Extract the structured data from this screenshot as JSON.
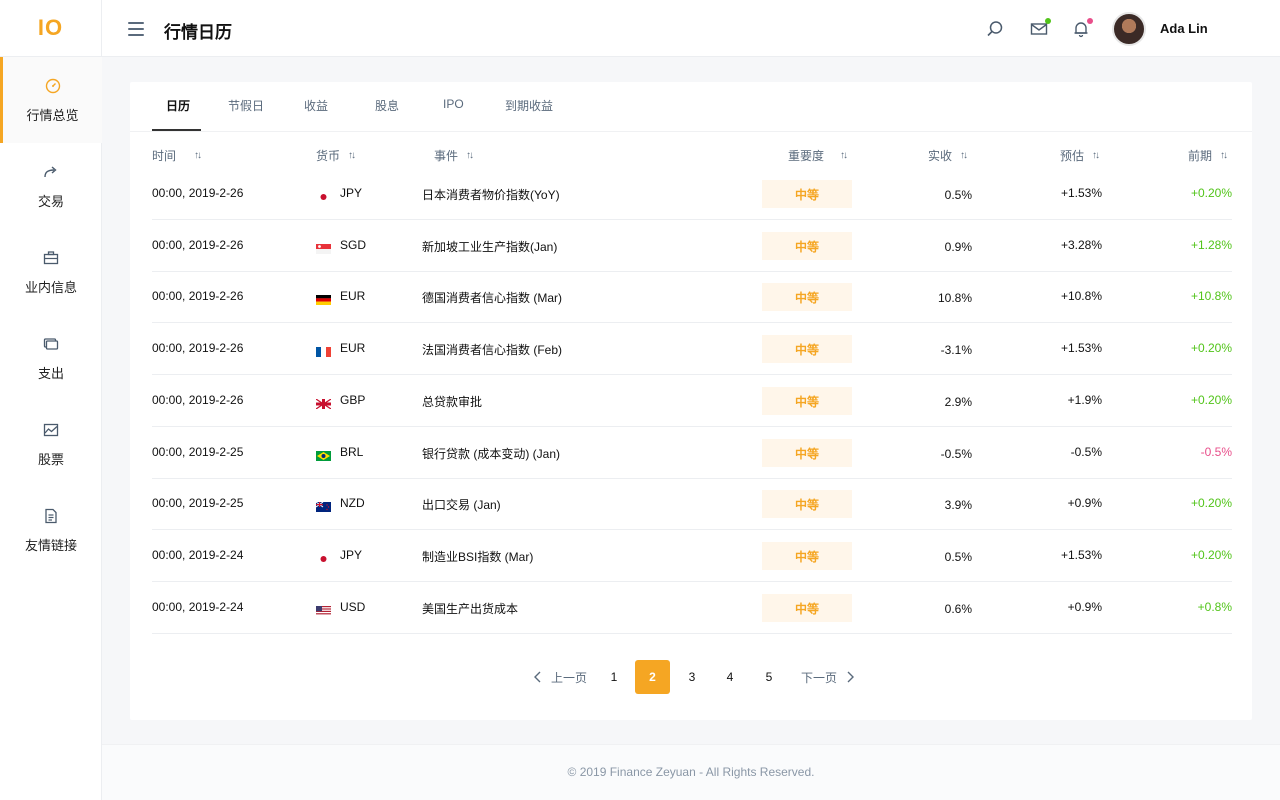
{
  "app": {
    "logo": "IO",
    "page_title": "行情日历",
    "username": "Ada Lin",
    "accent_color": "#f5a623"
  },
  "sidebar": {
    "items": [
      {
        "label": "行情总览",
        "icon": "speedometer-icon",
        "active": true
      },
      {
        "label": "交易",
        "icon": "share-arrow-icon"
      },
      {
        "label": "业内信息",
        "icon": "briefcase-icon"
      },
      {
        "label": "支出",
        "icon": "cards-icon"
      },
      {
        "label": "股票",
        "icon": "chart-icon"
      },
      {
        "label": "友情链接",
        "icon": "document-icon"
      }
    ]
  },
  "header": {
    "icons": [
      "search-icon",
      "mail-icon",
      "bell-icon"
    ]
  },
  "tabs": [
    {
      "label": "日历",
      "active": true
    },
    {
      "label": "节假日"
    },
    {
      "label": "收益"
    },
    {
      "label": "股息"
    },
    {
      "label": "IPO"
    },
    {
      "label": "到期收益"
    }
  ],
  "table": {
    "columns": [
      "时间",
      "货币",
      "事件",
      "重要度",
      "实收",
      "预估",
      "前期"
    ],
    "rows": [
      {
        "time": "00:00, 2019-2-26",
        "flag": "jp",
        "currency": "JPY",
        "event": "日本消费者物价指数(YoY)",
        "importance": "中等",
        "actual": "0.5%",
        "forecast": "+1.53%",
        "previous": "+0.20%",
        "prev_sign": "pos"
      },
      {
        "time": "00:00, 2019-2-26",
        "flag": "sg",
        "currency": "SGD",
        "event": "新加坡工业生产指数(Jan)",
        "importance": "中等",
        "actual": "0.9%",
        "forecast": "+3.28%",
        "previous": "+1.28%",
        "prev_sign": "pos"
      },
      {
        "time": "00:00, 2019-2-26",
        "flag": "de",
        "currency": "EUR",
        "event": "德国消费者信心指数 (Mar)",
        "importance": "中等",
        "actual": "10.8%",
        "forecast": "+10.8%",
        "previous": "+10.8%",
        "prev_sign": "pos"
      },
      {
        "time": "00:00, 2019-2-26",
        "flag": "fr",
        "currency": "EUR",
        "event": "法国消费者信心指数 (Feb)",
        "importance": "中等",
        "actual": "-3.1%",
        "forecast": "+1.53%",
        "previous": "+0.20%",
        "prev_sign": "pos"
      },
      {
        "time": "00:00, 2019-2-26",
        "flag": "gb",
        "currency": "GBP",
        "event": "总贷款审批",
        "importance": "中等",
        "actual": "2.9%",
        "forecast": "+1.9%",
        "previous": "+0.20%",
        "prev_sign": "pos"
      },
      {
        "time": "00:00, 2019-2-25",
        "flag": "br",
        "currency": "BRL",
        "event": "银行贷款 (成本变动) (Jan)",
        "importance": "中等",
        "actual": "-0.5%",
        "forecast": "-0.5%",
        "previous": "-0.5%",
        "prev_sign": "neg"
      },
      {
        "time": "00:00, 2019-2-25",
        "flag": "nz",
        "currency": "NZD",
        "event": "出口交易 (Jan)",
        "importance": "中等",
        "actual": "3.9%",
        "forecast": "+0.9%",
        "previous": "+0.20%",
        "prev_sign": "pos"
      },
      {
        "time": "00:00, 2019-2-24",
        "flag": "jp",
        "currency": "JPY",
        "event": "制造业BSI指数 (Mar)",
        "importance": "中等",
        "actual": "0.5%",
        "forecast": "+1.53%",
        "previous": "+0.20%",
        "prev_sign": "pos"
      },
      {
        "time": "00:00, 2019-2-24",
        "flag": "us",
        "currency": "USD",
        "event": "美国生产出货成本",
        "importance": "中等",
        "actual": "0.6%",
        "forecast": "+0.9%",
        "previous": "+0.8%",
        "prev_sign": "pos"
      }
    ]
  },
  "pagination": {
    "prev_label": "上一页",
    "next_label": "下一页",
    "pages": [
      "1",
      "2",
      "3",
      "4",
      "5"
    ],
    "current": "2"
  },
  "footer": {
    "text": "© 2019 Finance Zeyuan - All Rights Reserved."
  }
}
